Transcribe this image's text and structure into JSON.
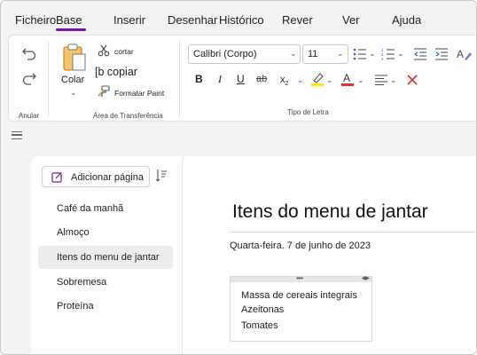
{
  "menu": {
    "tabs": [
      "Ficheiro",
      "Base",
      "Inserir",
      "Desenhar",
      "Histórico",
      "Rever",
      "Ver",
      "Ajuda"
    ],
    "active": "Base"
  },
  "ribbon": {
    "undo_group_label": "Anular",
    "paste_label": "Colar",
    "cut_label": "cortar",
    "copy_label": "[b copiar",
    "format_paint_label": "Formatar Paint",
    "clipboard_group_label": "Área de Transferência",
    "font_name": "Calibri (Corpo)",
    "font_size": "11",
    "font_group_label": "Tipo de Letra",
    "highlight_color": "#ffe500",
    "font_color": "#e03131"
  },
  "sidebar": {
    "add_page_label": "Adicionar página",
    "pages": [
      "Café da manhã",
      "Almoço",
      "Itens do menu de jantar",
      "Sobremesa",
      "Proteína"
    ],
    "selected_index": 2
  },
  "page": {
    "title": "Itens do menu de jantar",
    "date": "Quarta-feira. 7 de junho de 2023",
    "note_lines": [
      "Massa de cereais integrais",
      "Azeitonas",
      "Tomates"
    ]
  },
  "colors": {
    "accent": "#7719aa"
  }
}
